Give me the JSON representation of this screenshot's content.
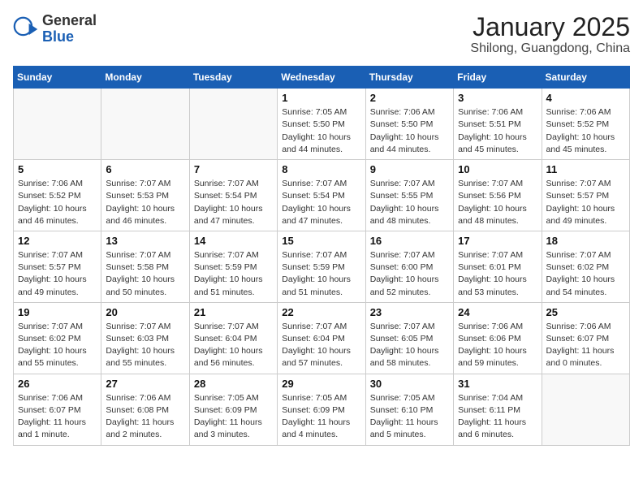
{
  "header": {
    "logo_general": "General",
    "logo_blue": "Blue",
    "month_title": "January 2025",
    "location": "Shilong, Guangdong, China"
  },
  "days_of_week": [
    "Sunday",
    "Monday",
    "Tuesday",
    "Wednesday",
    "Thursday",
    "Friday",
    "Saturday"
  ],
  "weeks": [
    [
      {
        "day": "",
        "info": ""
      },
      {
        "day": "",
        "info": ""
      },
      {
        "day": "",
        "info": ""
      },
      {
        "day": "1",
        "info": "Sunrise: 7:05 AM\nSunset: 5:50 PM\nDaylight: 10 hours\nand 44 minutes."
      },
      {
        "day": "2",
        "info": "Sunrise: 7:06 AM\nSunset: 5:50 PM\nDaylight: 10 hours\nand 44 minutes."
      },
      {
        "day": "3",
        "info": "Sunrise: 7:06 AM\nSunset: 5:51 PM\nDaylight: 10 hours\nand 45 minutes."
      },
      {
        "day": "4",
        "info": "Sunrise: 7:06 AM\nSunset: 5:52 PM\nDaylight: 10 hours\nand 45 minutes."
      }
    ],
    [
      {
        "day": "5",
        "info": "Sunrise: 7:06 AM\nSunset: 5:52 PM\nDaylight: 10 hours\nand 46 minutes."
      },
      {
        "day": "6",
        "info": "Sunrise: 7:07 AM\nSunset: 5:53 PM\nDaylight: 10 hours\nand 46 minutes."
      },
      {
        "day": "7",
        "info": "Sunrise: 7:07 AM\nSunset: 5:54 PM\nDaylight: 10 hours\nand 47 minutes."
      },
      {
        "day": "8",
        "info": "Sunrise: 7:07 AM\nSunset: 5:54 PM\nDaylight: 10 hours\nand 47 minutes."
      },
      {
        "day": "9",
        "info": "Sunrise: 7:07 AM\nSunset: 5:55 PM\nDaylight: 10 hours\nand 48 minutes."
      },
      {
        "day": "10",
        "info": "Sunrise: 7:07 AM\nSunset: 5:56 PM\nDaylight: 10 hours\nand 48 minutes."
      },
      {
        "day": "11",
        "info": "Sunrise: 7:07 AM\nSunset: 5:57 PM\nDaylight: 10 hours\nand 49 minutes."
      }
    ],
    [
      {
        "day": "12",
        "info": "Sunrise: 7:07 AM\nSunset: 5:57 PM\nDaylight: 10 hours\nand 49 minutes."
      },
      {
        "day": "13",
        "info": "Sunrise: 7:07 AM\nSunset: 5:58 PM\nDaylight: 10 hours\nand 50 minutes."
      },
      {
        "day": "14",
        "info": "Sunrise: 7:07 AM\nSunset: 5:59 PM\nDaylight: 10 hours\nand 51 minutes."
      },
      {
        "day": "15",
        "info": "Sunrise: 7:07 AM\nSunset: 5:59 PM\nDaylight: 10 hours\nand 51 minutes."
      },
      {
        "day": "16",
        "info": "Sunrise: 7:07 AM\nSunset: 6:00 PM\nDaylight: 10 hours\nand 52 minutes."
      },
      {
        "day": "17",
        "info": "Sunrise: 7:07 AM\nSunset: 6:01 PM\nDaylight: 10 hours\nand 53 minutes."
      },
      {
        "day": "18",
        "info": "Sunrise: 7:07 AM\nSunset: 6:02 PM\nDaylight: 10 hours\nand 54 minutes."
      }
    ],
    [
      {
        "day": "19",
        "info": "Sunrise: 7:07 AM\nSunset: 6:02 PM\nDaylight: 10 hours\nand 55 minutes."
      },
      {
        "day": "20",
        "info": "Sunrise: 7:07 AM\nSunset: 6:03 PM\nDaylight: 10 hours\nand 55 minutes."
      },
      {
        "day": "21",
        "info": "Sunrise: 7:07 AM\nSunset: 6:04 PM\nDaylight: 10 hours\nand 56 minutes."
      },
      {
        "day": "22",
        "info": "Sunrise: 7:07 AM\nSunset: 6:04 PM\nDaylight: 10 hours\nand 57 minutes."
      },
      {
        "day": "23",
        "info": "Sunrise: 7:07 AM\nSunset: 6:05 PM\nDaylight: 10 hours\nand 58 minutes."
      },
      {
        "day": "24",
        "info": "Sunrise: 7:06 AM\nSunset: 6:06 PM\nDaylight: 10 hours\nand 59 minutes."
      },
      {
        "day": "25",
        "info": "Sunrise: 7:06 AM\nSunset: 6:07 PM\nDaylight: 11 hours\nand 0 minutes."
      }
    ],
    [
      {
        "day": "26",
        "info": "Sunrise: 7:06 AM\nSunset: 6:07 PM\nDaylight: 11 hours\nand 1 minute."
      },
      {
        "day": "27",
        "info": "Sunrise: 7:06 AM\nSunset: 6:08 PM\nDaylight: 11 hours\nand 2 minutes."
      },
      {
        "day": "28",
        "info": "Sunrise: 7:05 AM\nSunset: 6:09 PM\nDaylight: 11 hours\nand 3 minutes."
      },
      {
        "day": "29",
        "info": "Sunrise: 7:05 AM\nSunset: 6:09 PM\nDaylight: 11 hours\nand 4 minutes."
      },
      {
        "day": "30",
        "info": "Sunrise: 7:05 AM\nSunset: 6:10 PM\nDaylight: 11 hours\nand 5 minutes."
      },
      {
        "day": "31",
        "info": "Sunrise: 7:04 AM\nSunset: 6:11 PM\nDaylight: 11 hours\nand 6 minutes."
      },
      {
        "day": "",
        "info": ""
      }
    ]
  ]
}
